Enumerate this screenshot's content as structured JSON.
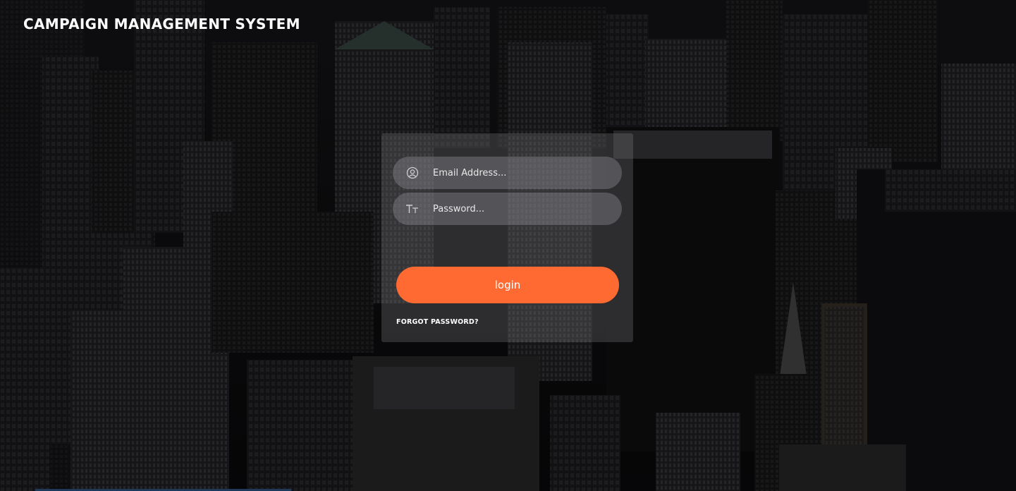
{
  "app": {
    "title": "CAMPAIGN MANAGEMENT SYSTEM"
  },
  "login_form": {
    "email": {
      "placeholder": "Email Address...",
      "value": "",
      "icon": "user-circle-icon"
    },
    "password": {
      "placeholder": "Password...",
      "value": "",
      "icon": "text-size-icon"
    },
    "login_label": "login",
    "forgot_label": "FORGOT PASSWORD?"
  },
  "colors": {
    "accent": "#ff6a33",
    "panel": "rgba(120,120,125,0.32)",
    "background": "#0b0a0c"
  }
}
